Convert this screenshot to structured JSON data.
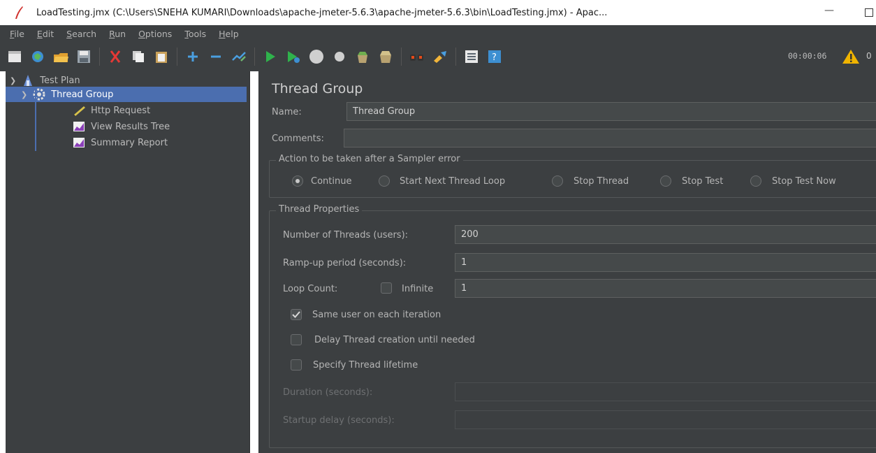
{
  "window": {
    "title": "LoadTesting.jmx (C:\\Users\\SNEHA KUMARI\\Downloads\\apache-jmeter-5.6.3\\apache-jmeter-5.6.3\\bin\\LoadTesting.jmx) - Apac...",
    "minimize_glyph": "—"
  },
  "menu": [
    "File",
    "Edit",
    "Search",
    "Run",
    "Options",
    "Tools",
    "Help"
  ],
  "toolbar": {
    "icons": [
      "new-icon",
      "templates-icon",
      "open-icon",
      "save-icon",
      "cut-icon",
      "copy-icon",
      "paste-icon",
      "expand-icon",
      "collapse-icon",
      "toggle-icon",
      "start-icon",
      "start-no-pause-icon",
      "stop-icon",
      "shutdown-icon",
      "clear-icon",
      "clear-all-icon",
      "search-icon",
      "reset-search-icon",
      "function-helper-icon",
      "help-icon"
    ],
    "timer": "00:00:06",
    "warning_count": "0"
  },
  "tree": {
    "test_plan": "Test Plan",
    "thread_group": "Thread Group",
    "children": [
      "Http Request",
      "View Results Tree",
      "Summary Report"
    ]
  },
  "panel": {
    "title": "Thread Group",
    "name_label": "Name:",
    "name_value": "Thread Group",
    "comments_label": "Comments:",
    "comments_value": "",
    "action_group_title": "Action to be taken after a Sampler error",
    "actions": [
      "Continue",
      "Start Next Thread Loop",
      "Stop Thread",
      "Stop Test",
      "Stop Test Now"
    ],
    "selected_action": "Continue",
    "props_title": "Thread Properties",
    "threads_label": "Number of Threads (users):",
    "threads_value": "200",
    "rampup_label": "Ramp-up period (seconds):",
    "rampup_value": "1",
    "loop_label": "Loop Count:",
    "infinite_label": "Infinite",
    "loop_value": "1",
    "same_user_label": "Same user on each iteration",
    "delay_label": "Delay Thread creation until needed",
    "lifetime_label": "Specify Thread lifetime",
    "duration_label": "Duration (seconds):",
    "startup_label": "Startup delay (seconds):"
  },
  "colors": {
    "background": "#3c3f41",
    "selection": "#4b6eaf",
    "field": "#45494a"
  }
}
